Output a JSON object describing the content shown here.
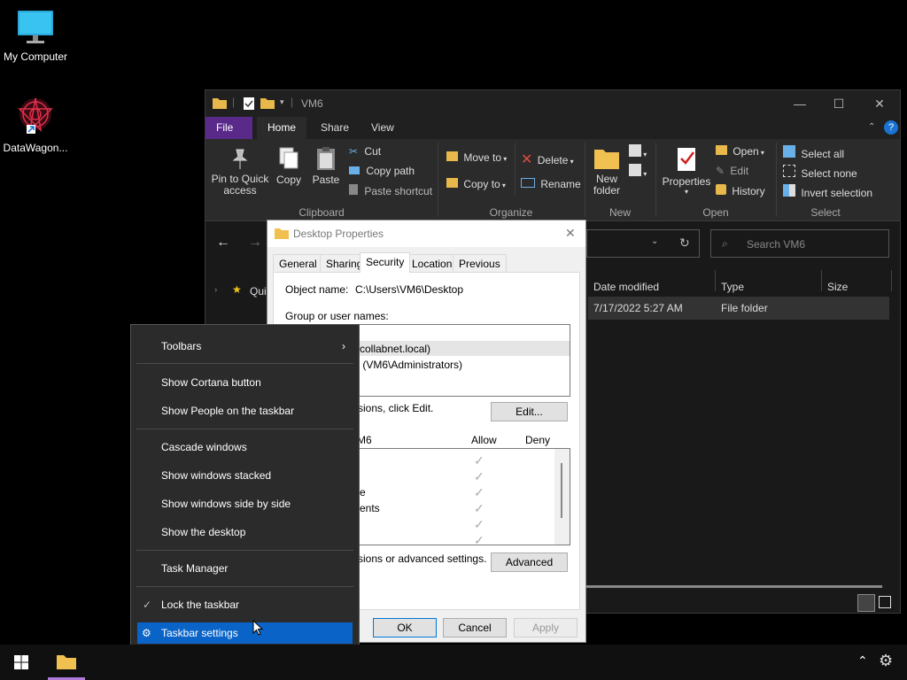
{
  "desktop": {
    "icons": [
      {
        "label": "My Computer",
        "icon": "monitor-icon"
      },
      {
        "label": "DataWagon...",
        "icon": "datawagon-app-icon"
      }
    ]
  },
  "explorer": {
    "title": "VM6",
    "controls": {
      "minimize": "—",
      "maximize": "☐",
      "close": "✕",
      "help": "?"
    },
    "ribbon_tabs": [
      "File",
      "Home",
      "Share",
      "View"
    ],
    "clipboard": {
      "pin_label": "Pin to Quick access",
      "copy": "Copy",
      "paste": "Paste",
      "cut": "Cut",
      "copy_path": "Copy path",
      "paste_shortcut": "Paste shortcut",
      "group": "Clipboard"
    },
    "organize": {
      "move_to": "Move to",
      "copy_to": "Copy to",
      "delete": "Delete",
      "rename": "Rename",
      "group": "Organize"
    },
    "new": {
      "new_folder": "New folder",
      "group": "New"
    },
    "open": {
      "properties": "Properties",
      "open": "Open",
      "edit": "Edit",
      "history": "History",
      "group": "Open"
    },
    "select": {
      "select_all": "Select all",
      "select_none": "Select none",
      "invert": "Invert selection",
      "group": "Select"
    },
    "search_placeholder": "Search VM6",
    "nav_partial": "Qui",
    "columns": {
      "date": "Date modified",
      "type": "Type",
      "size": "Size"
    },
    "row": {
      "date": "7/17/2022 5:27 AM",
      "type": "File folder"
    }
  },
  "dialog": {
    "title": "Desktop Properties",
    "tabs": [
      "General",
      "Sharing",
      "Security",
      "Location",
      "Previous Versions"
    ],
    "object_name_label": "Object name:",
    "object_name_value": "C:\\Users\\VM6\\Desktop",
    "group_label": "Group or user names:",
    "users": [
      "collabnet.local)",
      "s (VM6\\Administrators)"
    ],
    "change_perm_text": "sions, click Edit.",
    "edit_button": "Edit...",
    "perm_header": "M6",
    "allow": "Allow",
    "deny": "Deny",
    "perm_rows": [
      "",
      "",
      "e",
      "ents",
      "",
      ""
    ],
    "advanced_text": "sions or advanced settings.",
    "advanced_button": "Advanced",
    "ok": "OK",
    "cancel": "Cancel",
    "apply": "Apply"
  },
  "context_menu": {
    "toolbars": "Toolbars",
    "show_cortana": "Show Cortana button",
    "show_people": "Show People on the taskbar",
    "cascade": "Cascade windows",
    "stacked": "Show windows stacked",
    "side_by_side": "Show windows side by side",
    "show_desktop": "Show the desktop",
    "task_manager": "Task Manager",
    "lock_taskbar": "Lock the taskbar",
    "taskbar_settings": "Taskbar settings"
  },
  "colors": {
    "accent": "#0a64c8",
    "file_tab": "#5a2a8a",
    "dark_bg": "#191919"
  }
}
